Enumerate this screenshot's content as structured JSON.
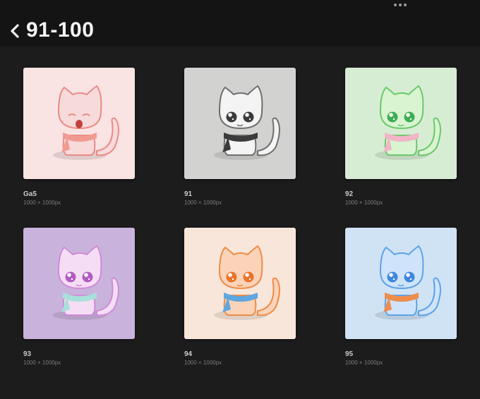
{
  "header": {
    "title": "91-100",
    "back_icon": "chevron-left-icon",
    "more_icon": "more-dots-icon"
  },
  "gallery": {
    "items": [
      {
        "name": "Ga5",
        "size": "1000 × 1000px",
        "bg": "#f9e3e3",
        "body": "#f7dada",
        "line": "#e98b86",
        "scarf": "#f19a92",
        "eye": "#e05a55",
        "crying": true
      },
      {
        "name": "91",
        "size": "1000 × 1000px",
        "bg": "#d2d2d1",
        "body": "#f4f4f4",
        "line": "#6f6f6f",
        "scarf": "#3b3b3b",
        "eye": "#3a3a3a",
        "crying": false
      },
      {
        "name": "92",
        "size": "1000 × 1000px",
        "bg": "#d6edd4",
        "body": "#d9f4d1",
        "line": "#6cc86a",
        "scarf": "#f2b4c6",
        "eye": "#3fae55",
        "crying": false
      },
      {
        "name": "93",
        "size": "1000 × 1000px",
        "bg": "#c9b3dc",
        "body": "#f5def5",
        "line": "#d18ad6",
        "scarf": "#a8e0da",
        "eye": "#b35ac2",
        "crying": false
      },
      {
        "name": "94",
        "size": "1000 × 1000px",
        "bg": "#f8e6da",
        "body": "#fbd3b8",
        "line": "#ef8b45",
        "scarf": "#5fa7de",
        "eye": "#e8742b",
        "crying": false
      },
      {
        "name": "95",
        "size": "1000 × 1000px",
        "bg": "#cfe3f4",
        "body": "#cfe4fb",
        "line": "#5ea2e7",
        "scarf": "#ee8d4c",
        "eye": "#3f87dd",
        "crying": false
      }
    ]
  }
}
